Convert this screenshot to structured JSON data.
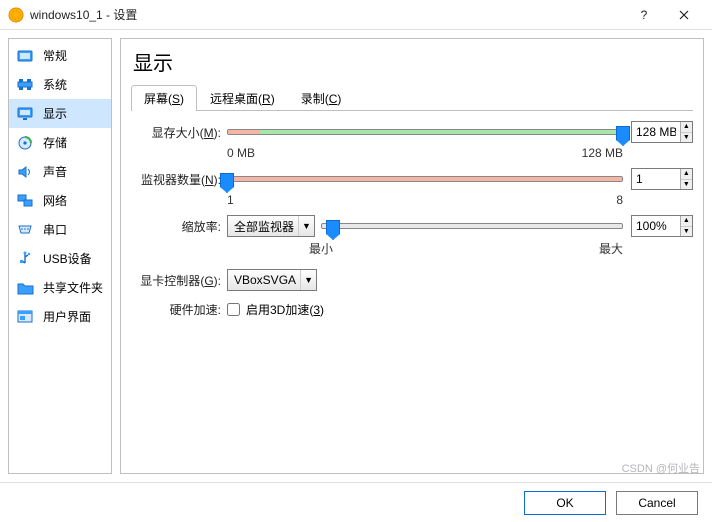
{
  "titlebar": {
    "title": "windows10_1 - 设置"
  },
  "sidebar": {
    "items": [
      {
        "label": "常规"
      },
      {
        "label": "系统"
      },
      {
        "label": "显示"
      },
      {
        "label": "存储"
      },
      {
        "label": "声音"
      },
      {
        "label": "网络"
      },
      {
        "label": "串口"
      },
      {
        "label": "USB设备"
      },
      {
        "label": "共享文件夹"
      },
      {
        "label": "用户界面"
      }
    ]
  },
  "content": {
    "heading": "显示",
    "tabs": [
      {
        "label": "屏幕",
        "mnemonic": "S"
      },
      {
        "label": "远程桌面",
        "mnemonic": "R"
      },
      {
        "label": "录制",
        "mnemonic": "C"
      }
    ],
    "video_memory": {
      "label": "显存大小",
      "mnemonic": "M",
      "value": "128 MB",
      "scale_min": "0 MB",
      "scale_max": "128 MB"
    },
    "monitor_count": {
      "label": "监视器数量",
      "mnemonic": "N",
      "value": "1",
      "scale_min": "1",
      "scale_max": "8"
    },
    "scale_factor": {
      "label": "缩放率",
      "dropdown": "全部监视器",
      "value": "100%",
      "scale_min": "最小",
      "scale_max": "最大"
    },
    "gpu_controller": {
      "label": "显卡控制器",
      "mnemonic": "G",
      "value": "VBoxSVGA"
    },
    "hw_accel": {
      "label": "硬件加速",
      "checkbox_label": "启用3D加速",
      "checkbox_mnemonic": "3"
    }
  },
  "footer": {
    "ok": "OK",
    "cancel": "Cancel"
  },
  "watermark": "CSDN @何业告"
}
